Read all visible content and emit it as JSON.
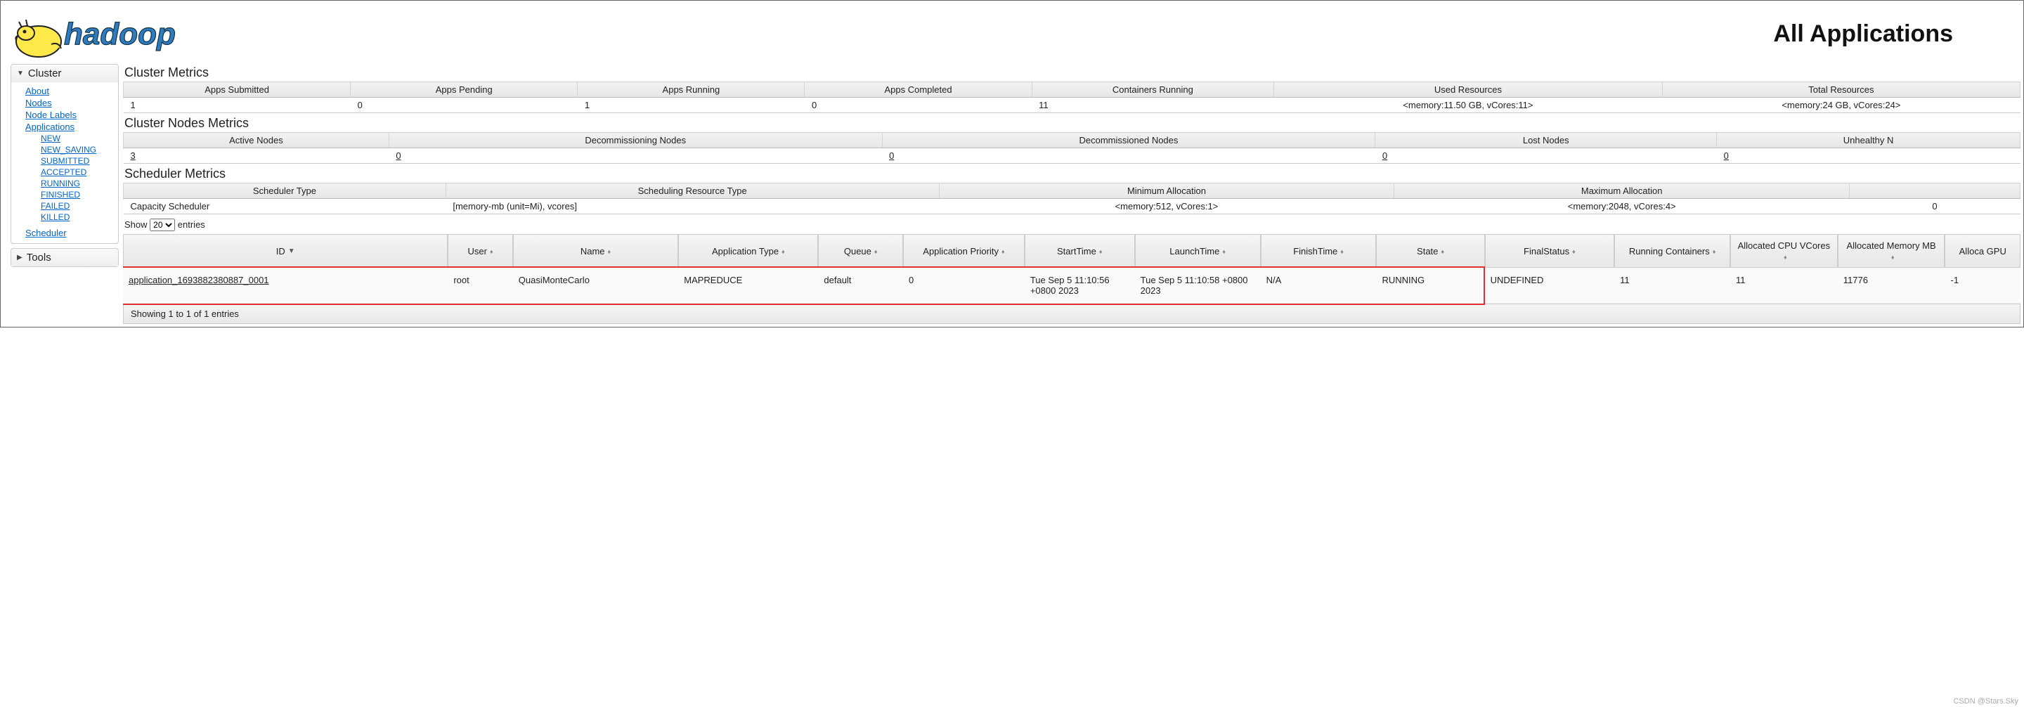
{
  "page_title": "All Applications",
  "logo_text": "hadoop",
  "sidebar": {
    "cluster_label": "Cluster",
    "tools_label": "Tools",
    "links": {
      "about": "About",
      "nodes": "Nodes",
      "node_labels": "Node Labels",
      "applications": "Applications",
      "scheduler": "Scheduler"
    },
    "app_states": {
      "new": "NEW",
      "new_saving": "NEW_SAVING",
      "submitted": "SUBMITTED",
      "accepted": "ACCEPTED",
      "running": "RUNNING",
      "finished": "FINISHED",
      "failed": "FAILED",
      "killed": "KILLED"
    }
  },
  "cluster_metrics": {
    "title": "Cluster Metrics",
    "headers": {
      "apps_submitted": "Apps Submitted",
      "apps_pending": "Apps Pending",
      "apps_running": "Apps Running",
      "apps_completed": "Apps Completed",
      "containers_running": "Containers Running",
      "used_resources": "Used Resources",
      "total_resources": "Total Resources"
    },
    "values": {
      "apps_submitted": "1",
      "apps_pending": "0",
      "apps_running": "1",
      "apps_completed": "0",
      "containers_running": "11",
      "used_resources": "<memory:11.50 GB, vCores:11>",
      "total_resources": "<memory:24 GB, vCores:24>"
    }
  },
  "cluster_nodes_metrics": {
    "title": "Cluster Nodes Metrics",
    "headers": {
      "active": "Active Nodes",
      "decommissioning": "Decommissioning Nodes",
      "decommissioned": "Decommissioned Nodes",
      "lost": "Lost Nodes",
      "unhealthy": "Unhealthy N"
    },
    "values": {
      "active": "3",
      "decommissioning": "0",
      "decommissioned": "0",
      "lost": "0",
      "unhealthy": "0"
    }
  },
  "scheduler_metrics": {
    "title": "Scheduler Metrics",
    "headers": {
      "type": "Scheduler Type",
      "res_type": "Scheduling Resource Type",
      "min_alloc": "Minimum Allocation",
      "max_alloc": "Maximum Allocation"
    },
    "values": {
      "type": "Capacity Scheduler",
      "res_type": "[memory-mb (unit=Mi), vcores]",
      "min_alloc": "<memory:512, vCores:1>",
      "max_alloc": "<memory:2048, vCores:4>",
      "extra": "0"
    }
  },
  "entries": {
    "show_prefix": "Show",
    "show_suffix": "entries",
    "options": [
      "20"
    ],
    "selected": "20"
  },
  "app_table": {
    "headers": {
      "id": "ID",
      "user": "User",
      "name": "Name",
      "type": "Application Type",
      "queue": "Queue",
      "priority": "Application Priority",
      "start": "StartTime",
      "launch": "LaunchTime",
      "finish": "FinishTime",
      "state": "State",
      "finalstatus": "FinalStatus",
      "running_containers": "Running Containers",
      "alloc_cpu": "Allocated CPU VCores",
      "alloc_mem": "Allocated Memory MB",
      "alloc_gpu": "Alloca GPU"
    },
    "row": {
      "id": "application_1693882380887_0001",
      "user": "root",
      "name": "QuasiMonteCarlo",
      "type": "MAPREDUCE",
      "queue": "default",
      "priority": "0",
      "start": "Tue Sep 5 11:10:56 +0800 2023",
      "launch": "Tue Sep 5 11:10:58 +0800 2023",
      "finish": "N/A",
      "state": "RUNNING",
      "finalstatus": "UNDEFINED",
      "running_containers": "11",
      "alloc_cpu": "11",
      "alloc_mem": "11776",
      "alloc_gpu": "-1"
    }
  },
  "footer": "Showing 1 to 1 of 1 entries",
  "watermark": "CSDN @Stars.Sky"
}
